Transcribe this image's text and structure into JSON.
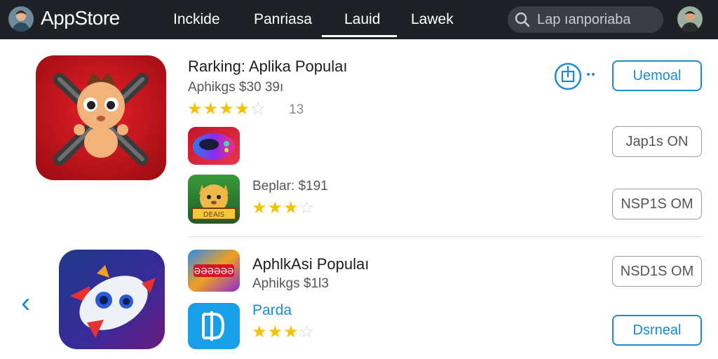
{
  "header": {
    "brand": "AppStore",
    "tabs": [
      "Inckide",
      "Panriasa",
      "Lauid",
      "Lawek"
    ],
    "active_tab": "Lauid",
    "search_placeholder": "Lap ıanporiaba"
  },
  "featured": {
    "title": "Rarking: Aplika Populaı",
    "subtitle": "Aphikgs $30 39ı",
    "rating": 4.5,
    "rating_count": "13",
    "button": "Uemoal",
    "second_button": "Jap1s ON"
  },
  "list": [
    {
      "subtitle": "Beplar: $191",
      "rating": 3.5,
      "button": "NSP1S OM"
    }
  ],
  "second_section": {
    "mini_icon_text": "ƏƏƏƏƏƏ",
    "title": "AphlkAsi Populaı",
    "subtitle": "Aphikgs $1Ɩ3",
    "button": "NSD1S OM",
    "item_label": "Parda",
    "item_rating": 3.5,
    "item_button": "Dsrneal"
  },
  "colors": {
    "topbar": "#1e2227",
    "accent": "#1a8ad6",
    "star": "#f5c200"
  },
  "icons": [
    "profile-avatar-icon",
    "search-icon",
    "share-icon",
    "chevron-left-icon"
  ]
}
